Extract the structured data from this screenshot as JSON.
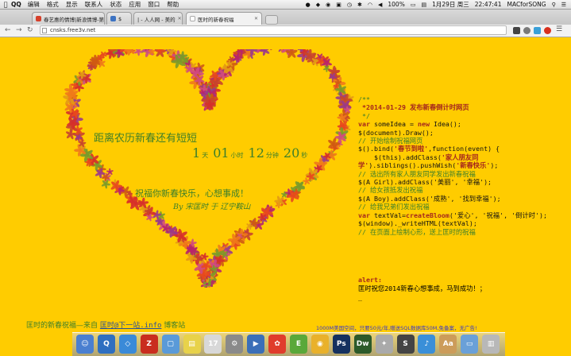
{
  "menubar": {
    "app_name": "QQ",
    "menus": [
      "编辑",
      "格式",
      "显示",
      "联系人",
      "状态",
      "应用",
      "窗口",
      "帮助"
    ],
    "battery": "100%",
    "date": "1月29日 周三",
    "time": "22:47:41",
    "user": "MACforSONG"
  },
  "tabs": [
    {
      "title": "春艺惠的情博|新浪情博-第什",
      "favicon_color": "#d6402b"
    },
    {
      "title": "$",
      "favicon_color": "#3d73c2"
    },
    {
      "title": "| - 人人网 - 美的",
      "favicon_color": "#1f5ec9"
    },
    {
      "title": "医时的新春祝福",
      "favicon_color": "#cccccc"
    }
  ],
  "toolbar": {
    "url": "cnsks.free3v.net"
  },
  "page": {
    "heading": "距离农历新春还有短短",
    "countdown": {
      "days": "1",
      "days_unit": "天",
      "hours": "01",
      "hours_unit": "小时",
      "minutes": "12",
      "minutes_unit": "分钟",
      "seconds": "20",
      "seconds_unit": "秒"
    },
    "wish": "祝福你新春快乐，心想事成！",
    "signature": "By 宋匡时 于 辽宁鞍山",
    "footer_prefix": "匡时的新春祝福—来自",
    "footer_link": "匡时@下一站.info",
    "footer_suffix": "博客站",
    "ad_text": "1000M美国空间，只要50元/年,赠送SQL数据库50M,免备案，无广告!"
  },
  "code": {
    "c1": "/**",
    "c2": " *2014-01-29 发布新春倒计时网页",
    "c3": " */",
    "l1_kw": "var",
    "l1_a": " someIdea = ",
    "l1_new": "new",
    "l1_b": " Idea();",
    "l2": "$(document).Draw();",
    "c4": "// 开始绘制祝福网页",
    "l3_a": "$().bind(",
    "l3_str": "'春节到啦'",
    "l3_b": ",function(event) {",
    "l4_a": "    $(this).addClass(",
    "l4_str": "'家人朋友同学'",
    "l4_b": ").siblings().pushWish(",
    "l4_str2": "'新春快乐'",
    "l4_c": ");",
    "c5": "// 选出所有家人朋友同学发出新春祝福",
    "l5": "$(A Girl).addClass('美丽', '幸福');",
    "c6": "// 给女孩抵发出祝福",
    "l6": "$(A Boy).addClass('成熟', '找到幸福');",
    "c7": "// 给我兄弟们发出祝福",
    "l7_kw": "var",
    "l7_a": " textVal=",
    "l7_fn": "createBloom",
    "l7_b": "('爱心', '祝福', '倒计时');",
    "l8": "$(window)._writeHTML(textVal);",
    "c8": "// 在页面上绘制心形，送上匡时的祝福",
    "alert_label": "alert:",
    "alert_text": "匡时祝您2014新春心想事成，马到成功！；",
    "cursor": "_"
  },
  "dock_icons": [
    "finder-icon",
    "quicktime-icon",
    "dropbox-icon",
    "filezilla-icon",
    "preview-icon",
    "stickies-icon",
    "calendar-icon",
    "system-preferences-icon",
    "keynote-icon",
    "qq-icon",
    "evernote-icon",
    "chrome-icon",
    "photoshop-icon",
    "dreamweaver-icon",
    "launchpad-icon",
    "sublime-icon",
    "itunes-icon",
    "dictionary-icon",
    "folder-icon",
    "trash-icon"
  ],
  "colors": {
    "page_bg": "#ffcc00",
    "heading_green": "#3d7f2a",
    "code_red": "#a5271d",
    "link_blue": "#2a4f99"
  }
}
